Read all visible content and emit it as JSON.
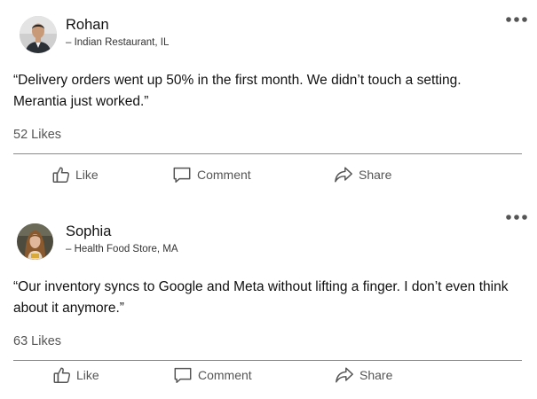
{
  "posts": [
    {
      "author": "Rohan",
      "meta": "– Indian Restaurant, IL",
      "quote": "“Delivery orders went up 50% in the first month. We didn’t touch a setting. Merantia just worked.”",
      "likes": "52 Likes",
      "actions": {
        "like": "Like",
        "comment": "Comment",
        "share": "Share"
      },
      "avatar": "man-in-suit-photo"
    },
    {
      "author": "Sophia",
      "meta": "– Health Food Store, MA",
      "quote": "“Our inventory syncs to Google and Meta without lifting a finger. I don’t even think about it anymore.”",
      "likes": "63 Likes",
      "actions": {
        "like": "Like",
        "comment": "Comment",
        "share": "Share"
      },
      "avatar": "woman-portrait-photo"
    }
  ],
  "icons": {
    "more": "more-horizontal-icon",
    "like": "thumbs-up-icon",
    "comment": "comment-bubble-icon",
    "share": "share-arrow-icon"
  },
  "colors": {
    "text": "#111111",
    "muted": "#555555",
    "divider": "#8a8a8a",
    "icon": "#555555"
  }
}
